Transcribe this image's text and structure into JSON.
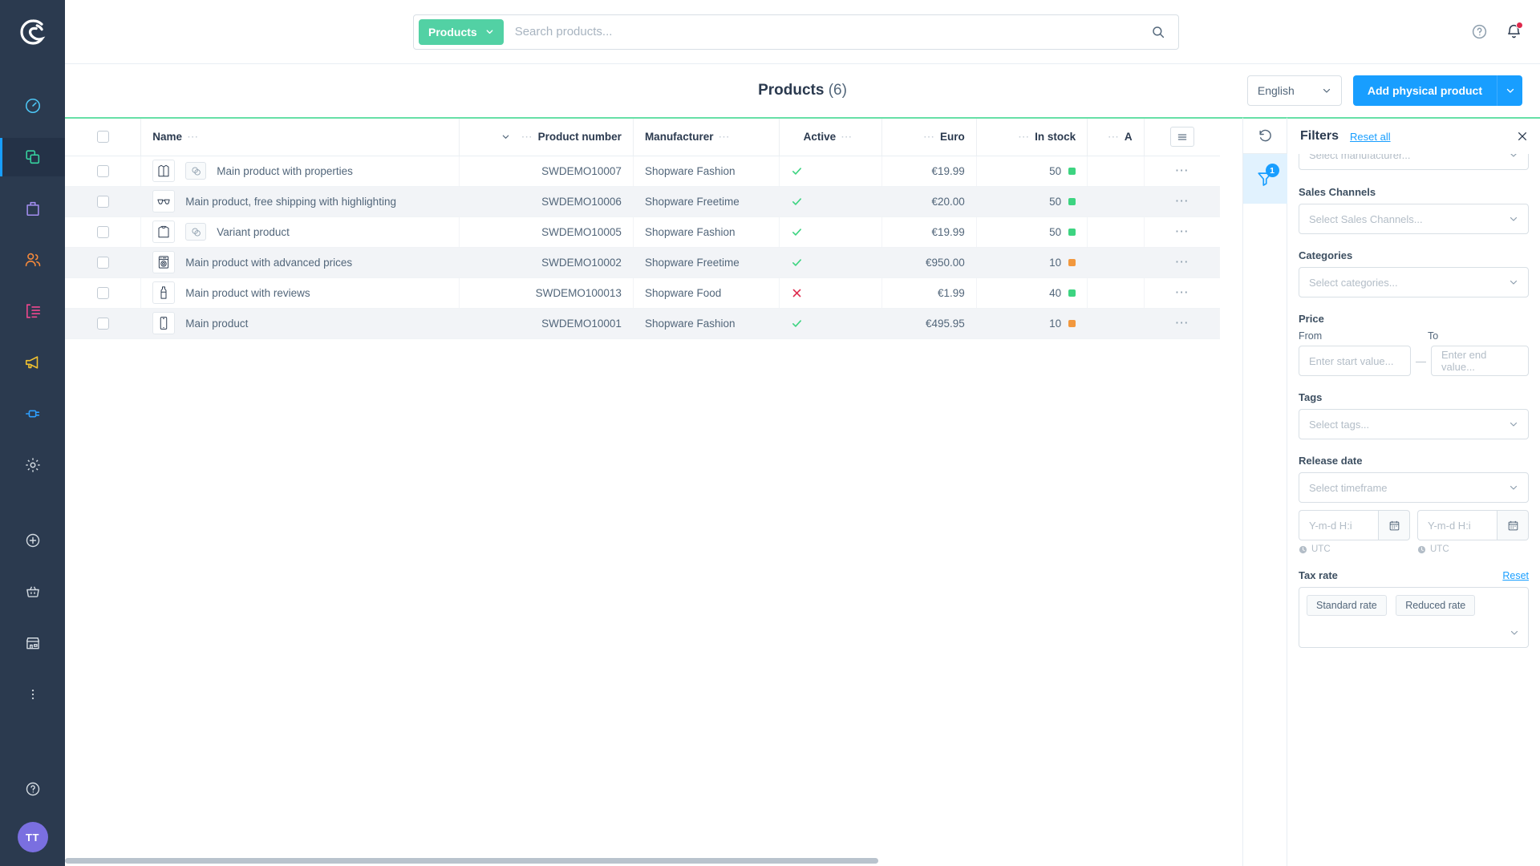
{
  "app": {
    "brand": "shopware",
    "logo_icon": "shopware-logo-icon"
  },
  "sidebar": {
    "items": [
      {
        "id": "dashboard",
        "icon": "dashboard-gauge-icon",
        "color": "#4dc6f5",
        "active": false
      },
      {
        "id": "catalogues",
        "icon": "catalogues-stacked-squares-icon",
        "color": "#37d4a0",
        "active": true
      },
      {
        "id": "orders",
        "icon": "orders-bag-icon",
        "color": "#a38ef0",
        "active": false
      },
      {
        "id": "customers",
        "icon": "customers-people-icon",
        "color": "#f5893b",
        "active": false
      },
      {
        "id": "content",
        "icon": "content-list-icon",
        "color": "#f1478f",
        "active": false
      },
      {
        "id": "marketing",
        "icon": "marketing-megaphone-icon",
        "color": "#f2c230",
        "active": false
      },
      {
        "id": "extensions",
        "icon": "extensions-plug-icon",
        "color": "#2f9fff",
        "active": false
      },
      {
        "id": "settings",
        "icon": "settings-gear-icon",
        "color": "#d3dae1",
        "active": false
      }
    ],
    "quick_items": [
      {
        "id": "add",
        "icon": "plus-circle-icon"
      },
      {
        "id": "basket",
        "icon": "shopping-basket-icon"
      },
      {
        "id": "storefront",
        "icon": "storefront-icon"
      },
      {
        "id": "more",
        "icon": "more-vertical-icon"
      }
    ],
    "bottom": [
      {
        "id": "help",
        "icon": "help-circle-icon"
      }
    ],
    "avatar_initials": "TT"
  },
  "topbar": {
    "search_scope_label": "Products",
    "search_scope_caret": "chevron-down-icon",
    "search_placeholder": "Search products...",
    "search_icon": "search-magnifier-icon",
    "help_icon": "help-circle-icon",
    "notification_icon": "bell-icon"
  },
  "header": {
    "title": "Products",
    "count": "(6)",
    "language": "English",
    "language_caret": "chevron-down-icon",
    "add_product_label": "Add physical product",
    "add_product_caret": "chevron-down-icon"
  },
  "table": {
    "columns": [
      {
        "key": "select",
        "label": "",
        "align": "center",
        "dots": false,
        "sorted": false
      },
      {
        "key": "name",
        "label": "Name",
        "align": "left",
        "dots": true,
        "sorted": false
      },
      {
        "key": "product_number",
        "label": "Product number",
        "align": "right",
        "dots": true,
        "sorted": true,
        "sort_icon": "chevron-down-icon"
      },
      {
        "key": "manufacturer",
        "label": "Manufacturer",
        "align": "left",
        "dots": true,
        "sorted": false
      },
      {
        "key": "active",
        "label": "Active",
        "align": "center",
        "dots": true,
        "sorted": false
      },
      {
        "key": "euro",
        "label": "Euro",
        "align": "right",
        "dots": true,
        "sorted": false
      },
      {
        "key": "in_stock",
        "label": "In stock",
        "align": "right",
        "dots": true,
        "sorted": false
      },
      {
        "key": "available",
        "label": "A",
        "align": "right",
        "dots": true,
        "sorted": false
      },
      {
        "key": "settings",
        "label": "",
        "align": "center",
        "dots": false,
        "sorted": false,
        "icon": "table-settings-icon"
      }
    ],
    "rows": [
      {
        "image_icon": "jacket-icon",
        "variant": true,
        "name": "Main product with properties",
        "product_number": "SWDEMO10007",
        "manufacturer": "Shopware Fashion",
        "active": true,
        "euro": "€19.99",
        "in_stock": "50",
        "stock_color": "#3dd481",
        "context_icon": "more-horizontal-icon"
      },
      {
        "image_icon": "sunglasses-icon",
        "variant": false,
        "name": "Main product, free shipping with highlighting",
        "product_number": "SWDEMO10006",
        "manufacturer": "Shopware Freetime",
        "active": true,
        "euro": "€20.00",
        "in_stock": "50",
        "stock_color": "#3dd481",
        "context_icon": "more-horizontal-icon"
      },
      {
        "image_icon": "sweater-icon",
        "variant": true,
        "name": "Variant product",
        "product_number": "SWDEMO10005",
        "manufacturer": "Shopware Fashion",
        "active": true,
        "euro": "€19.99",
        "in_stock": "50",
        "stock_color": "#3dd481",
        "context_icon": "more-horizontal-icon"
      },
      {
        "image_icon": "washing-machine-icon",
        "variant": false,
        "name": "Main product with advanced prices",
        "product_number": "SWDEMO10002",
        "manufacturer": "Shopware Freetime",
        "active": true,
        "euro": "€950.00",
        "in_stock": "10",
        "stock_color": "#f2983e",
        "context_icon": "more-horizontal-icon"
      },
      {
        "image_icon": "bottle-icon",
        "variant": false,
        "name": "Main product with reviews",
        "product_number": "SWDEMO100013",
        "manufacturer": "Shopware Food",
        "active": false,
        "euro": "€1.99",
        "in_stock": "40",
        "stock_color": "#3dd481",
        "context_icon": "more-horizontal-icon"
      },
      {
        "image_icon": "phone-icon",
        "variant": false,
        "name": "Main product",
        "product_number": "SWDEMO10001",
        "manufacturer": "Shopware Fashion",
        "active": true,
        "euro": "€495.95",
        "in_stock": "10",
        "stock_color": "#f2983e",
        "context_icon": "more-horizontal-icon"
      }
    ]
  },
  "rail": {
    "refresh_icon": "refresh-counterclockwise-icon",
    "filter_icon": "funnel-filter-icon",
    "filter_badge": "1"
  },
  "filters": {
    "title": "Filters",
    "reset_all": "Reset all",
    "close_icon": "close-x-icon",
    "manufacturer_placeholder": "Select manufacturer...",
    "groups": [
      {
        "label": "Sales Channels",
        "placeholder": "Select Sales Channels..."
      },
      {
        "label": "Categories",
        "placeholder": "Select categories..."
      }
    ],
    "price": {
      "label": "Price",
      "from_label": "From",
      "to_label": "To",
      "from_placeholder": "Enter start value...",
      "to_placeholder": "Enter end value...",
      "separator": "—"
    },
    "tags": {
      "label": "Tags",
      "placeholder": "Select tags..."
    },
    "release_date": {
      "label": "Release date",
      "timeframe_placeholder": "Select timeframe",
      "date_placeholder": "Y-m-d H:i",
      "timezone": "UTC",
      "calendar_icon": "calendar-icon",
      "clock_icon": "clock-icon"
    },
    "tax_rate": {
      "label": "Tax rate",
      "reset": "Reset",
      "chips": [
        "Standard rate",
        "Reduced rate"
      ],
      "caret_icon": "chevron-down-icon"
    }
  },
  "colors": {
    "brand_dark": "#2b3a4f",
    "accent_blue": "#189eff",
    "accent_green": "#52d1a4",
    "top_border_green": "#67e0a7",
    "stock_ok": "#3dd481",
    "stock_low": "#f2983e",
    "active_yes": "#3dd481",
    "active_no": "#de294c"
  }
}
